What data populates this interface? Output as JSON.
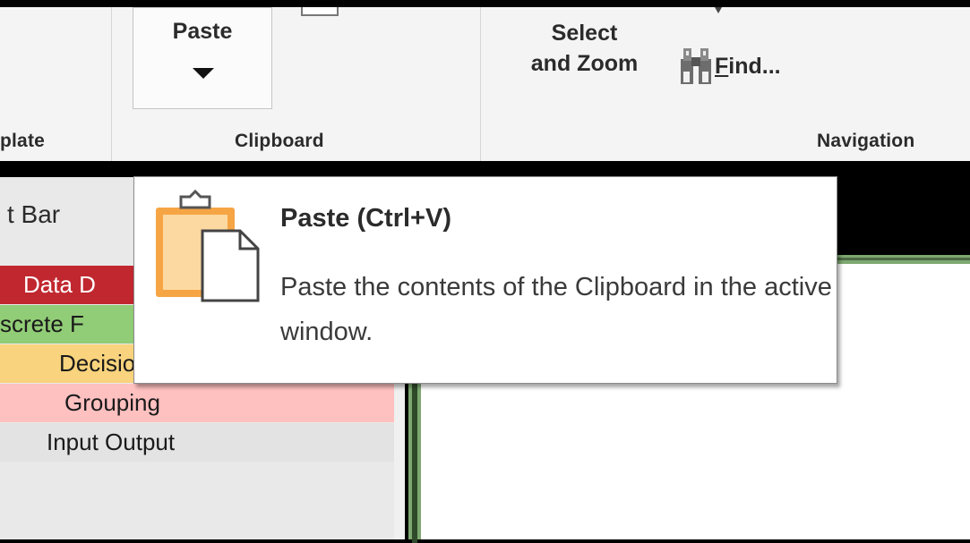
{
  "ribbon": {
    "groups": {
      "template_label": "plate",
      "clipboard_label": "Clipboard",
      "navigation_label": "Navigation"
    },
    "paste_label": "Paste",
    "select_zoom_line1": "Select",
    "select_zoom_line2": "and Zoom",
    "find_first_letter": "F",
    "find_rest": "ind..."
  },
  "left_panel": {
    "bar_label": "t Bar",
    "categories": [
      {
        "label": "Data D",
        "color": "#c1272f"
      },
      {
        "label": "screte F",
        "color": "#91cc76"
      },
      {
        "label": "Decisions",
        "color": "#f9d37d"
      },
      {
        "label": "Grouping",
        "color": "#ffc0c0"
      },
      {
        "label": "Input Output",
        "color": "#e3e3e3"
      }
    ]
  },
  "tooltip": {
    "title": "Paste (Ctrl+V)",
    "description": "Paste the contents of the Clipboard in the active window.",
    "icon": "clipboard-paste-icon"
  }
}
